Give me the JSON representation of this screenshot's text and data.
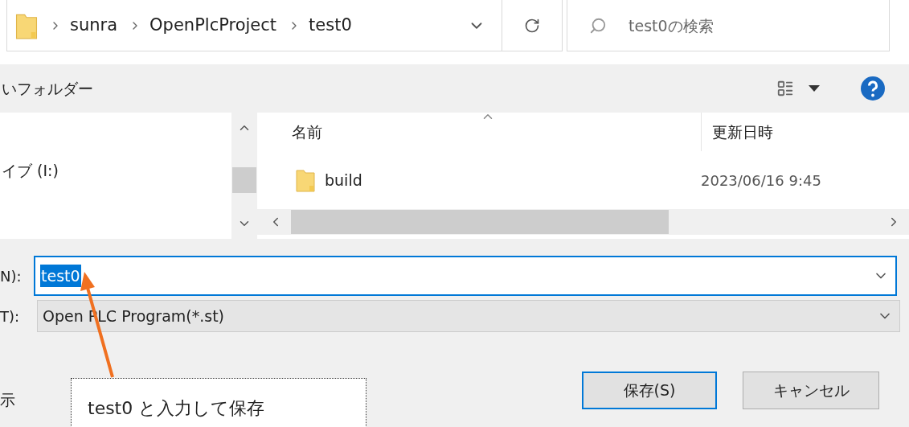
{
  "address_bar": {
    "breadcrumbs": [
      "sunra",
      "OpenPlcProject",
      "test0"
    ]
  },
  "search": {
    "placeholder": "test0の検索"
  },
  "toolbar": {
    "new_folder": "いフォルダー"
  },
  "nav_pane": {
    "items": [
      {
        "label": "イブ (I:)"
      }
    ]
  },
  "file_list": {
    "columns": [
      "名前",
      "更新日時"
    ],
    "rows": [
      {
        "name": "build",
        "modified": "2023/06/16 9:45"
      }
    ]
  },
  "file_name": {
    "label": "N):",
    "value": "test0",
    "value_selected": true
  },
  "file_type": {
    "label": "T):",
    "value": "Open PLC Program(*.st)"
  },
  "hide_folders": "示",
  "buttons": [
    {
      "label": "保存(S)",
      "default": true
    },
    {
      "label": "キャンセル",
      "default": false
    }
  ],
  "annotation": {
    "text": "test0 と入力して保存"
  }
}
